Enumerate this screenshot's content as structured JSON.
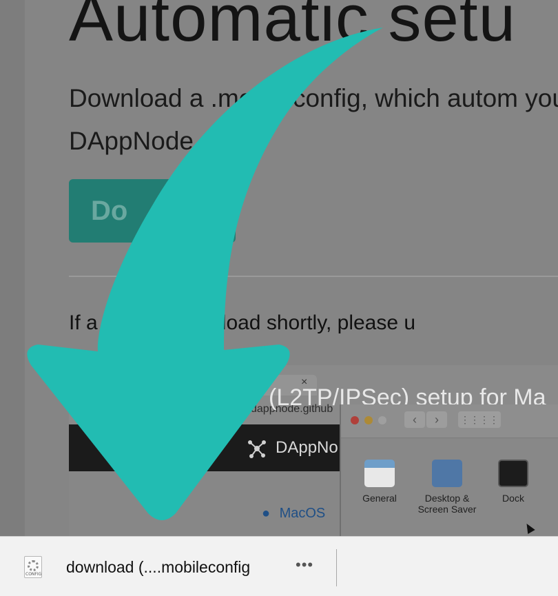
{
  "page": {
    "heading": "Automatic setu",
    "description": "Download a .mobileconfig, which autom your DAppNode",
    "download_button": "Do",
    "note": "If a     start to download shortly, please u"
  },
  "preview": {
    "title": "(L2TP/IPSec) setup for Ma",
    "tab_close": "×",
    "url": "dappnode.github",
    "brand": "DAppNo",
    "os_label": "MacOS",
    "window": {
      "back": "‹",
      "forward": "›",
      "grid": "⋮⋮⋮⋮",
      "prefs": [
        {
          "label": "General"
        },
        {
          "label_line1": "Desktop &",
          "label_line2": "Screen Saver"
        },
        {
          "label": "Dock"
        }
      ]
    }
  },
  "download_shelf": {
    "file_label": "download (....mobileconfig",
    "file_icon_text": "CONFIG",
    "more_menu": "•••"
  },
  "colors": {
    "overlay_arrow": "#22bcb2",
    "button": "#227d73",
    "shelf_bg": "#f2f2f2"
  }
}
